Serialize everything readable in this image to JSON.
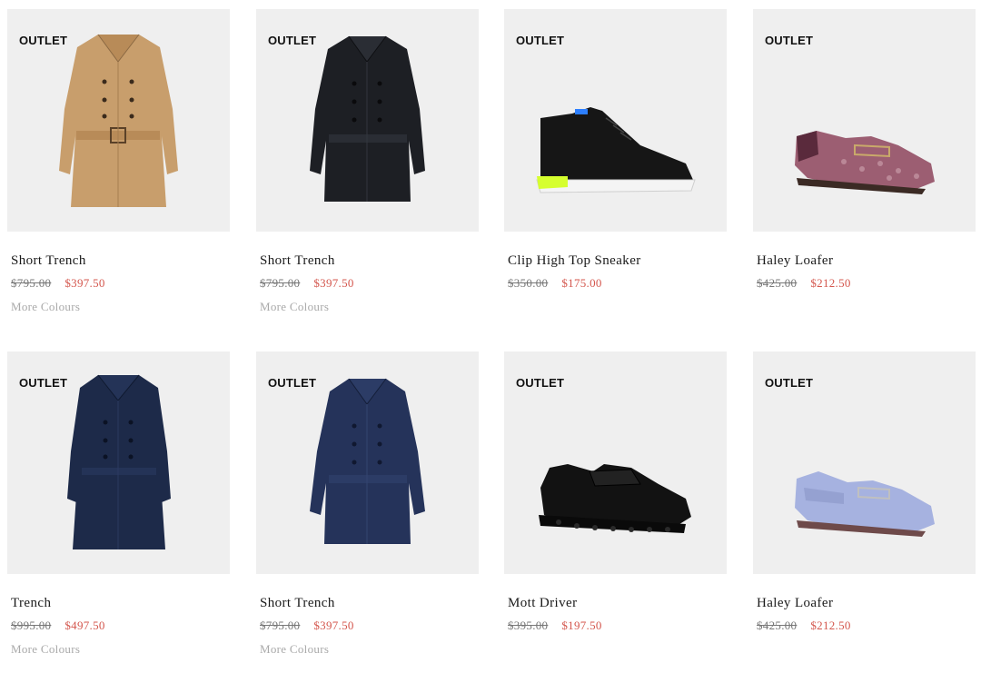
{
  "products": [
    {
      "badge": "OUTLET",
      "name": "Short Trench",
      "was": "$795.00",
      "now": "$397.50",
      "more": "More Colours",
      "image": "tan-trench-coat",
      "color": "#c89e6c"
    },
    {
      "badge": "OUTLET",
      "name": "Short Trench",
      "was": "$795.00",
      "now": "$397.50",
      "more": "More Colours",
      "image": "black-trench-coat",
      "color": "#1d1f24"
    },
    {
      "badge": "OUTLET",
      "name": "Clip High Top Sneaker",
      "was": "$350.00",
      "now": "$175.00",
      "more": "",
      "image": "black-high-top-sneaker",
      "color": "#161616"
    },
    {
      "badge": "OUTLET",
      "name": "Haley Loafer",
      "was": "$425.00",
      "now": "$212.50",
      "more": "",
      "image": "signature-jacquard-loafer",
      "color": "#9c5e72"
    },
    {
      "badge": "OUTLET",
      "name": "Trench",
      "was": "$995.00",
      "now": "$497.50",
      "more": "More Colours",
      "image": "navy-long-trench-coat",
      "color": "#1d2a49"
    },
    {
      "badge": "OUTLET",
      "name": "Short Trench",
      "was": "$795.00",
      "now": "$397.50",
      "more": "More Colours",
      "image": "navy-short-trench-coat",
      "color": "#25335a"
    },
    {
      "badge": "OUTLET",
      "name": "Mott Driver",
      "was": "$395.00",
      "now": "$197.50",
      "more": "",
      "image": "black-leather-driver",
      "color": "#121212"
    },
    {
      "badge": "OUTLET",
      "name": "Haley Loafer",
      "was": "$425.00",
      "now": "$212.50",
      "more": "",
      "image": "lavender-loafer",
      "color": "#a6b2e0"
    }
  ]
}
